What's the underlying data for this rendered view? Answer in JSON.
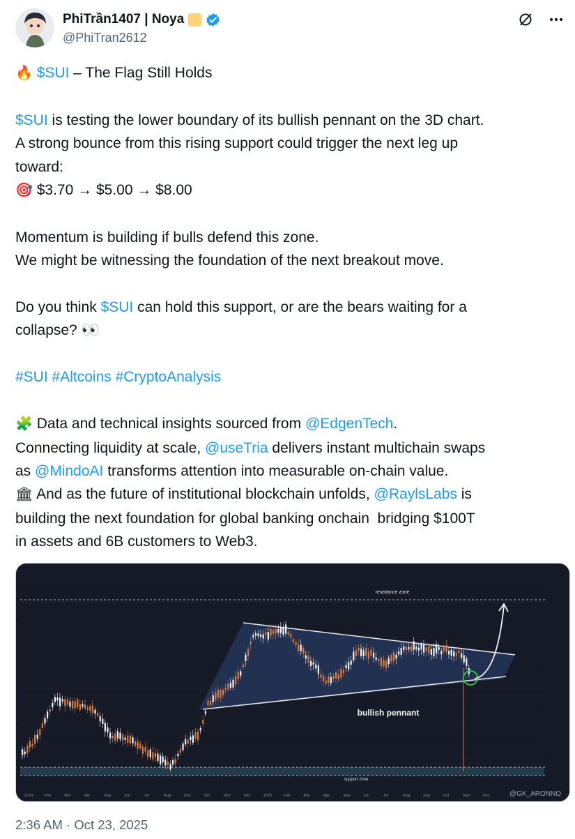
{
  "author": {
    "display_name": "PhiTrần1407 | Noya",
    "handle": "@PhiTran2612"
  },
  "tweet": {
    "line1_emoji": "🔥",
    "line1_link": "$SUI",
    "line1_text": " – The Flag Still Holds",
    "p1_link": "$SUI",
    "p1_text": " is testing the lower boundary of its bullish pennant on the 3D chart.",
    "p1_line2": "A strong bounce from this rising support could trigger the next leg up",
    "p1_line3": "toward:",
    "targets_emoji": "🎯",
    "targets": " $3.70 → $5.00 → $8.00",
    "p2_line1": "Momentum is building if bulls defend this zone.",
    "p2_line2": "We might be witnessing the foundation of the next breakout move.",
    "p3_text_a": "Do you think ",
    "p3_link": "$SUI",
    "p3_text_b": " can hold this support, or are the bears waiting for a",
    "p3_line2": "collapse? 👀",
    "hashtags": "#SUI #Altcoins #CryptoAnalysis",
    "p4_emoji": "🧩",
    "p4_text_a": " Data and technical insights sourced from ",
    "p4_link1": "@EdgenTech",
    "p4_text_b": ".",
    "p4_line2_a": "Connecting liquidity at scale, ",
    "p4_link2": "@useTria",
    "p4_line2_b": " delivers instant multichain swaps",
    "p4_line3_a": "as ",
    "p4_link3": "@MindoAI",
    "p4_line3_b": " transforms attention into measurable on-chain value.",
    "p4_line4_emoji": "🏛",
    "p4_line4_a": " And as the future of institutional blockchain unfolds, ",
    "p4_link4": "@RaylsLabs",
    "p4_line4_b": " is",
    "p4_line5": "building the next foundation for global banking onchain  bridging $100T",
    "p4_line6": "in assets and 6B customers to Web3."
  },
  "chart": {
    "labels": {
      "resistance": "resistance zone",
      "pennant": "bullish pennant",
      "support": "support zone",
      "watermark": "@GK_ARONNO"
    },
    "x_ticks": [
      "2024",
      "Feb",
      "Mar",
      "Apr",
      "May",
      "Jun",
      "Jul",
      "Aug",
      "Sep",
      "Oct",
      "Nov",
      "Dec",
      "2025",
      "Feb",
      "Mar",
      "Apr",
      "May",
      "Jun",
      "Jul",
      "Aug",
      "Sep",
      "Oct",
      "Nov",
      "Dec"
    ],
    "colors": {
      "up": "#f5f5f5",
      "down": "#e07b39",
      "bg": "#151a26",
      "pennant_fill": "#24355a",
      "accent": "#2ecc40"
    }
  },
  "timestamp": "2:36 AM · Oct 23, 2025"
}
